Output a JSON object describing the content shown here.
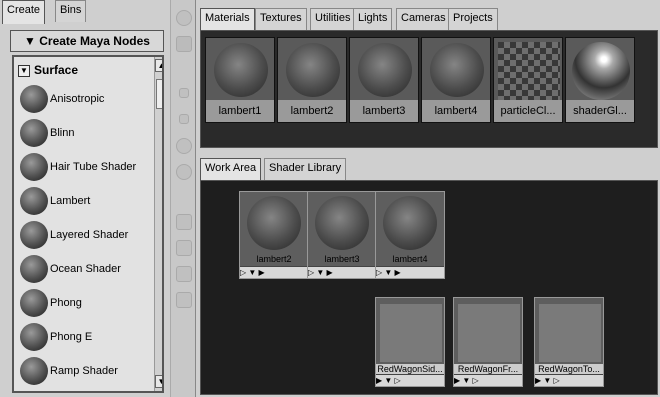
{
  "left_tabs": [
    {
      "label": "Create",
      "active": true
    },
    {
      "label": "Bins",
      "active": false
    }
  ],
  "create_button": "Create Maya Nodes",
  "category": "Surface",
  "nodes": [
    {
      "label": "Anisotropic"
    },
    {
      "label": "Blinn"
    },
    {
      "label": "Hair Tube Shader"
    },
    {
      "label": "Lambert"
    },
    {
      "label": "Layered Shader"
    },
    {
      "label": "Ocean Shader"
    },
    {
      "label": "Phong"
    },
    {
      "label": "Phong E"
    },
    {
      "label": "Ramp Shader"
    }
  ],
  "top_tabs": [
    {
      "label": "Materials",
      "active": true
    },
    {
      "label": "Textures"
    },
    {
      "label": "Utilities"
    },
    {
      "label": "Lights"
    },
    {
      "label": "Cameras"
    },
    {
      "label": "Projects"
    }
  ],
  "materials": [
    {
      "label": "lambert1",
      "kind": "sphere"
    },
    {
      "label": "lambert2",
      "kind": "sphere"
    },
    {
      "label": "lambert3",
      "kind": "sphere"
    },
    {
      "label": "lambert4",
      "kind": "sphere"
    },
    {
      "label": "particleCl...",
      "kind": "checker"
    },
    {
      "label": "shaderGl...",
      "kind": "chrome"
    }
  ],
  "bottom_tabs": [
    {
      "label": "Work Area",
      "active": true
    },
    {
      "label": "Shader Library"
    }
  ],
  "work_nodes": [
    {
      "label": "lambert2"
    },
    {
      "label": "lambert3"
    },
    {
      "label": "lambert4"
    }
  ],
  "wagon_nodes": [
    {
      "label": "RedWagonSid..."
    },
    {
      "label": "RedWagonFr..."
    },
    {
      "label": "RedWagonTo..."
    }
  ]
}
